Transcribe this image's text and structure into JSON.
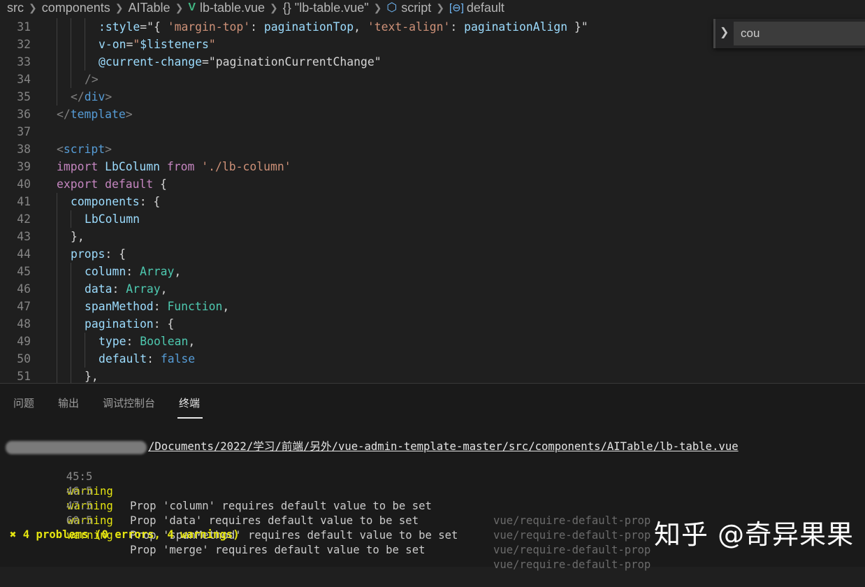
{
  "breadcrumb": {
    "items": [
      "src",
      "components",
      "AITable",
      "lb-table.vue",
      "{} \"lb-table.vue\"",
      "script",
      "default"
    ],
    "vue_icon": "vue-logo-icon",
    "script_icon": "cube-icon",
    "var_icon": "variable-icon"
  },
  "editor": {
    "lines": [
      {
        "n": "31",
        "indent": 3,
        "tokens": [
          [
            ":style",
            "t-attr"
          ],
          [
            "=",
            "t-plain"
          ],
          [
            "\"{ ",
            "t-plain"
          ],
          [
            "'margin-top'",
            "t-str"
          ],
          [
            ": ",
            "t-plain"
          ],
          [
            "paginationTop",
            "t-var"
          ],
          [
            ", ",
            "t-plain"
          ],
          [
            "'text-align'",
            "t-str"
          ],
          [
            ": ",
            "t-plain"
          ],
          [
            "paginationAlign",
            "t-var"
          ],
          [
            " }\"",
            "t-plain"
          ]
        ]
      },
      {
        "n": "32",
        "indent": 3,
        "tokens": [
          [
            "v-on",
            "t-attr"
          ],
          [
            "=",
            "t-plain"
          ],
          [
            "\"",
            "t-str"
          ],
          [
            "$listeners",
            "t-var"
          ],
          [
            "\"",
            "t-str"
          ]
        ]
      },
      {
        "n": "33",
        "indent": 3,
        "tokens": [
          [
            "@current-change",
            "t-attr"
          ],
          [
            "=",
            "t-plain"
          ],
          [
            "\"paginationCurrentChange\"",
            "t-plain"
          ]
        ]
      },
      {
        "n": "34",
        "indent": 2,
        "tokens": [
          [
            "/>",
            "t-punc"
          ]
        ]
      },
      {
        "n": "35",
        "indent": 1,
        "tokens": [
          [
            "</",
            "t-punc"
          ],
          [
            "div",
            "t-tag"
          ],
          [
            ">",
            "t-punc"
          ]
        ]
      },
      {
        "n": "36",
        "indent": 0,
        "tokens": [
          [
            "</",
            "t-punc"
          ],
          [
            "template",
            "t-tag"
          ],
          [
            ">",
            "t-punc"
          ]
        ]
      },
      {
        "n": "37",
        "indent": 0,
        "tokens": []
      },
      {
        "n": "38",
        "indent": 0,
        "tokens": [
          [
            "<",
            "t-punc"
          ],
          [
            "script",
            "t-tag"
          ],
          [
            ">",
            "t-punc"
          ]
        ]
      },
      {
        "n": "39",
        "indent": 0,
        "tokens": [
          [
            "import",
            "t-kw"
          ],
          [
            " ",
            "t-plain"
          ],
          [
            "LbColumn",
            "t-var"
          ],
          [
            " ",
            "t-plain"
          ],
          [
            "from",
            "t-kw"
          ],
          [
            " ",
            "t-plain"
          ],
          [
            "'./lb-column'",
            "t-str"
          ]
        ]
      },
      {
        "n": "40",
        "indent": 0,
        "tokens": [
          [
            "export",
            "t-kw"
          ],
          [
            " ",
            "t-plain"
          ],
          [
            "default",
            "t-kw"
          ],
          [
            " {",
            "t-plain"
          ]
        ]
      },
      {
        "n": "41",
        "indent": 1,
        "tokens": [
          [
            "components",
            "t-var"
          ],
          [
            ": {",
            "t-plain"
          ]
        ]
      },
      {
        "n": "42",
        "indent": 2,
        "tokens": [
          [
            "LbColumn",
            "t-var"
          ]
        ]
      },
      {
        "n": "43",
        "indent": 1,
        "tokens": [
          [
            "},",
            "t-plain"
          ]
        ]
      },
      {
        "n": "44",
        "indent": 1,
        "tokens": [
          [
            "props",
            "t-var"
          ],
          [
            ": {",
            "t-plain"
          ]
        ]
      },
      {
        "n": "45",
        "indent": 2,
        "tokens": [
          [
            "column",
            "t-var"
          ],
          [
            ": ",
            "t-plain"
          ],
          [
            "Array",
            "t-cls"
          ],
          [
            ",",
            "t-plain"
          ]
        ]
      },
      {
        "n": "46",
        "indent": 2,
        "tokens": [
          [
            "data",
            "t-var"
          ],
          [
            ": ",
            "t-plain"
          ],
          [
            "Array",
            "t-cls"
          ],
          [
            ",",
            "t-plain"
          ]
        ]
      },
      {
        "n": "47",
        "indent": 2,
        "tokens": [
          [
            "spanMethod",
            "t-var"
          ],
          [
            ": ",
            "t-plain"
          ],
          [
            "Function",
            "t-cls"
          ],
          [
            ",",
            "t-plain"
          ]
        ]
      },
      {
        "n": "48",
        "indent": 2,
        "tokens": [
          [
            "pagination",
            "t-var"
          ],
          [
            ": {",
            "t-plain"
          ]
        ]
      },
      {
        "n": "49",
        "indent": 3,
        "tokens": [
          [
            "type",
            "t-var"
          ],
          [
            ": ",
            "t-plain"
          ],
          [
            "Boolean",
            "t-cls"
          ],
          [
            ",",
            "t-plain"
          ]
        ]
      },
      {
        "n": "50",
        "indent": 3,
        "tokens": [
          [
            "default",
            "t-var"
          ],
          [
            ": ",
            "t-plain"
          ],
          [
            "false",
            "t-bool"
          ]
        ]
      },
      {
        "n": "51",
        "indent": 2,
        "tokens": [
          [
            "},",
            "t-plain"
          ]
        ]
      }
    ]
  },
  "find_widget": {
    "value": "cou",
    "toggle_icon": "chevron-right-icon"
  },
  "panel": {
    "tabs": [
      "问题",
      "输出",
      "调试控制台",
      "终端"
    ],
    "active_tab": "终端"
  },
  "terminal": {
    "file_path": "/Documents/2022/学习/前端/另外/vue-admin-template-master/src/components/AITable/lb-table.vue",
    "warnings": [
      {
        "loc": "45:5",
        "level": "warning",
        "msg": "Prop 'column' requires default value to be set",
        "rule": "vue/require-default-prop"
      },
      {
        "loc": "46:5",
        "level": "warning",
        "msg": "Prop 'data' requires default value to be set",
        "rule": "vue/require-default-prop"
      },
      {
        "loc": "47:5",
        "level": "warning",
        "msg": "Prop 'spanMethod' requires default value to be set",
        "rule": "vue/require-default-prop"
      },
      {
        "loc": "60:5",
        "level": "warning",
        "msg": "Prop 'merge' requires default value to be set",
        "rule": "vue/require-default-prop"
      }
    ],
    "summary": "✖ 4 problems (0 errors, 4 warnings)"
  },
  "watermark": {
    "text": "知乎 @奇异果果"
  }
}
